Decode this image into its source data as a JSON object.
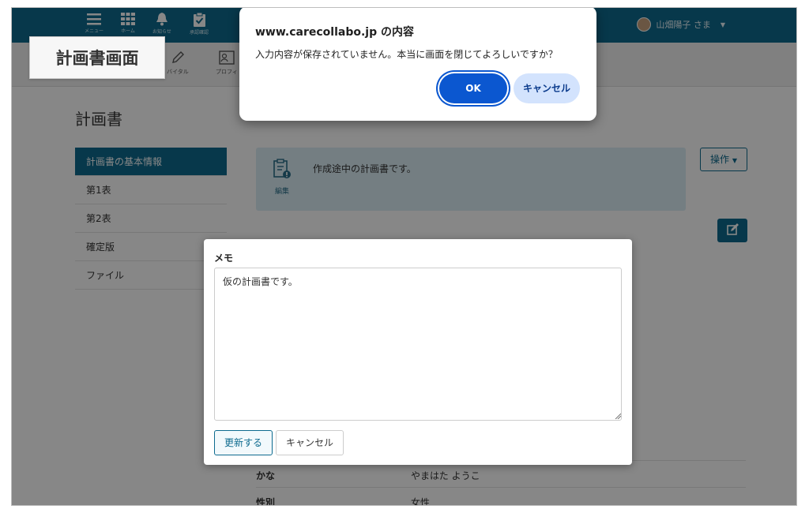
{
  "browser_dialog": {
    "title": "www.carecollabo.jp の内容",
    "message": "入力内容が保存されていません。本当に画面を閉じてよろしいですか？",
    "ok_label": "OK",
    "cancel_label": "キャンセル"
  },
  "page_label": "計画書画面",
  "topbar": {
    "icons": [
      {
        "icon": "menu-icon",
        "caption": "メニュー"
      },
      {
        "icon": "apps-grid-icon",
        "caption": "ホーム"
      },
      {
        "icon": "bell-icon",
        "caption": "お知らせ"
      },
      {
        "icon": "clipboard-check-icon",
        "caption": "承認確認"
      }
    ],
    "user_name": "山畑陽子 さま"
  },
  "subnav": {
    "items": [
      {
        "icon": "pencil-icon",
        "label": "バイタル"
      },
      {
        "icon": "profile-card-icon",
        "label": "プロフィ"
      }
    ]
  },
  "main": {
    "title": "計画書",
    "sidebar": [
      {
        "label": "計画書の基本情報",
        "active": true
      },
      {
        "label": "第1表",
        "active": false
      },
      {
        "label": "第2表",
        "active": false
      },
      {
        "label": "確定版",
        "active": false
      },
      {
        "label": "ファイル",
        "active": false
      }
    ],
    "notice": {
      "icon_caption": "編集",
      "message": "作成途中の計画書です。"
    },
    "ops_label": "操作",
    "info_rows": [
      {
        "key": "かな",
        "value": "やまはた ようこ"
      },
      {
        "key": "性別",
        "value": "女性"
      }
    ]
  },
  "memo_modal": {
    "title": "メモ",
    "text": "仮の計画書です。",
    "update_label": "更新する",
    "cancel_label": "キャンセル"
  },
  "colors": {
    "brand": "#0e6b8f",
    "dialog_primary": "#0b57d0",
    "dialog_secondary": "#d3e3fd"
  }
}
